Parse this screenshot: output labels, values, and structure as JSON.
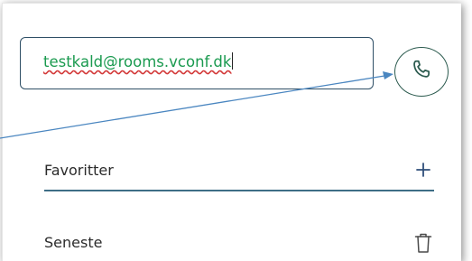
{
  "address_input": {
    "value": "testkald@rooms.vconf.dk"
  },
  "favorites": {
    "label": "Favoritter",
    "action_icon": "plus-icon"
  },
  "recent": {
    "label": "Seneste",
    "action_icon": "trash-icon"
  },
  "call_button": {
    "icon": "phone-icon"
  },
  "colors": {
    "input_text": "#1a9a4f",
    "input_border": "#2f4f66",
    "favorites_line": "#3e6e86",
    "recent_line": "#2fb36a",
    "plus_icon": "#2f4f7a",
    "annotation_arrow": "#4a86c0"
  }
}
